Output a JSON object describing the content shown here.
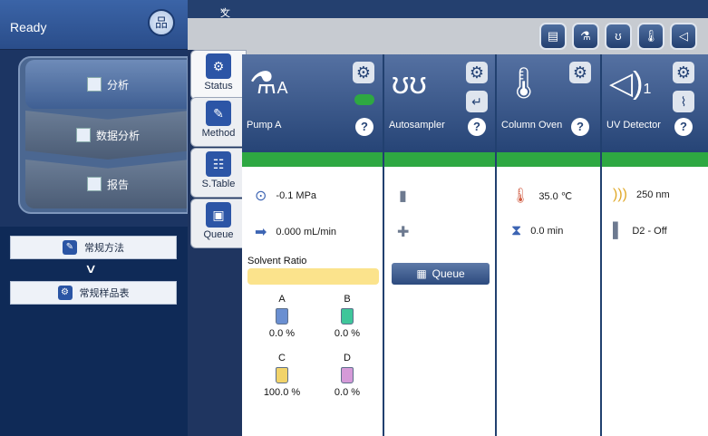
{
  "left": {
    "status": "Ready",
    "network_icon": "network-icon",
    "nav": [
      {
        "label": "分析",
        "icon": "analysis-icon"
      },
      {
        "label": "数据分析",
        "icon": "data-analysis-icon"
      },
      {
        "label": "报告",
        "icon": "report-icon"
      }
    ],
    "lower": [
      {
        "label": "常规方法",
        "icon": "method-icon"
      },
      {
        "label": "常规样品表",
        "icon": "sample-table-icon"
      }
    ]
  },
  "main": {
    "header": "文件列表",
    "toolbar_icons": [
      "document-icon",
      "pump-icon",
      "autosampler-icon",
      "oven-icon",
      "uv-detector-icon"
    ],
    "vtabs": [
      {
        "label": "Status",
        "icon": "status-gear-icon"
      },
      {
        "label": "Method",
        "icon": "method-pencil-icon"
      },
      {
        "label": "S.Table",
        "icon": "sample-table-icon"
      },
      {
        "label": "Queue",
        "icon": "queue-icon"
      }
    ],
    "modules": {
      "pump": {
        "name": "Pump A",
        "pressure": "-0.1 MPa",
        "flow": "0.000 mL/min",
        "solvent_label": "Solvent Ratio",
        "bottles": [
          {
            "letter": "A",
            "value": "0.0 %",
            "color": "#6a8fd1"
          },
          {
            "letter": "B",
            "value": "0.0 %",
            "color": "#3fc69a"
          },
          {
            "letter": "C",
            "value": "100.0 %",
            "color": "#f1d36a"
          },
          {
            "letter": "D",
            "value": "0.0 %",
            "color": "#d59ad8"
          }
        ]
      },
      "autosampler": {
        "name": "Autosampler",
        "queue_label": "Queue"
      },
      "oven": {
        "name": "Column Oven",
        "temp": "35.0 ℃",
        "time": "0.0 min"
      },
      "uv": {
        "name": "UV Detector",
        "wavelength": "250 nm",
        "lamp": "D2 - Off",
        "channel": "1"
      }
    }
  }
}
